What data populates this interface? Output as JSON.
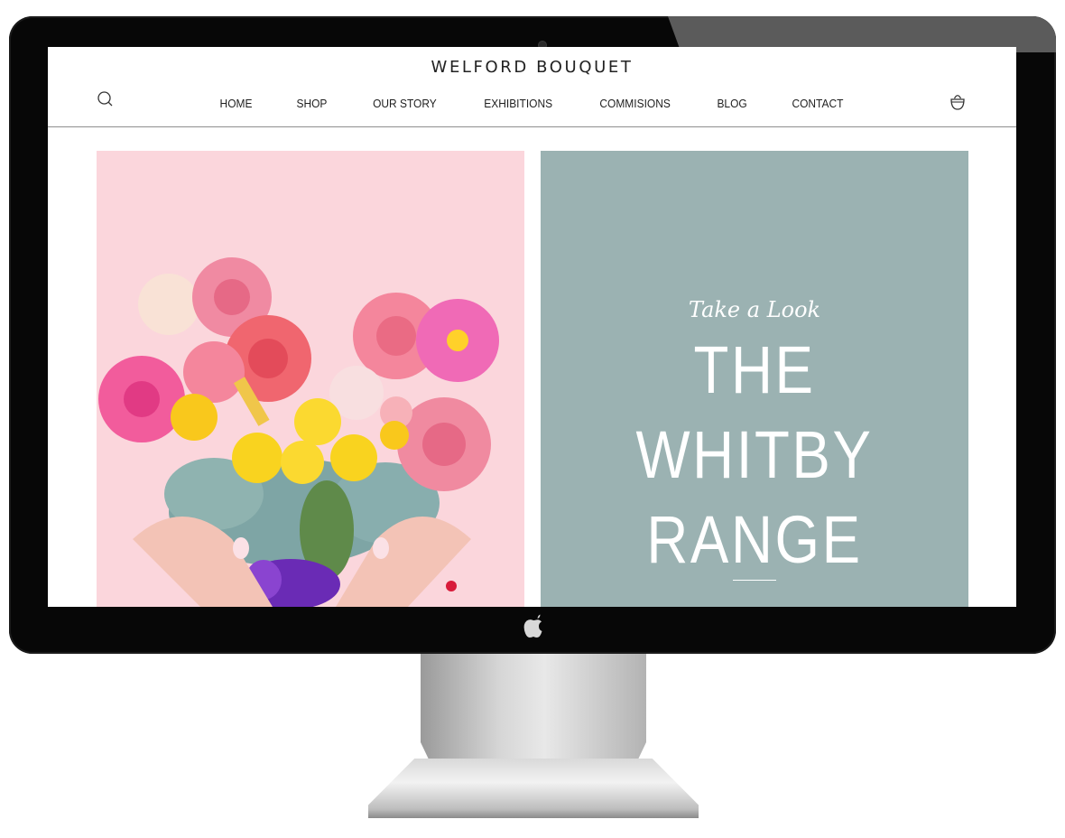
{
  "site": {
    "brand": "WELFORD BOUQUET",
    "nav": [
      "HOME",
      "SHOP",
      "OUR STORY",
      "EXHIBITIONS",
      "COMMISIONS",
      "BLOG",
      "CONTACT"
    ],
    "icons": {
      "search": "search-icon",
      "cart": "shopping-bag-icon"
    }
  },
  "hero": {
    "tagline": "Take a Look",
    "title_lines": [
      "THE",
      "WHITBY",
      "RANGE"
    ],
    "image": "flower-heart-bouquet",
    "colors": {
      "left_panel": "#fbd6dc",
      "right_panel": "#9bb2b2"
    }
  },
  "device": {
    "type": "desktop-monitor"
  }
}
